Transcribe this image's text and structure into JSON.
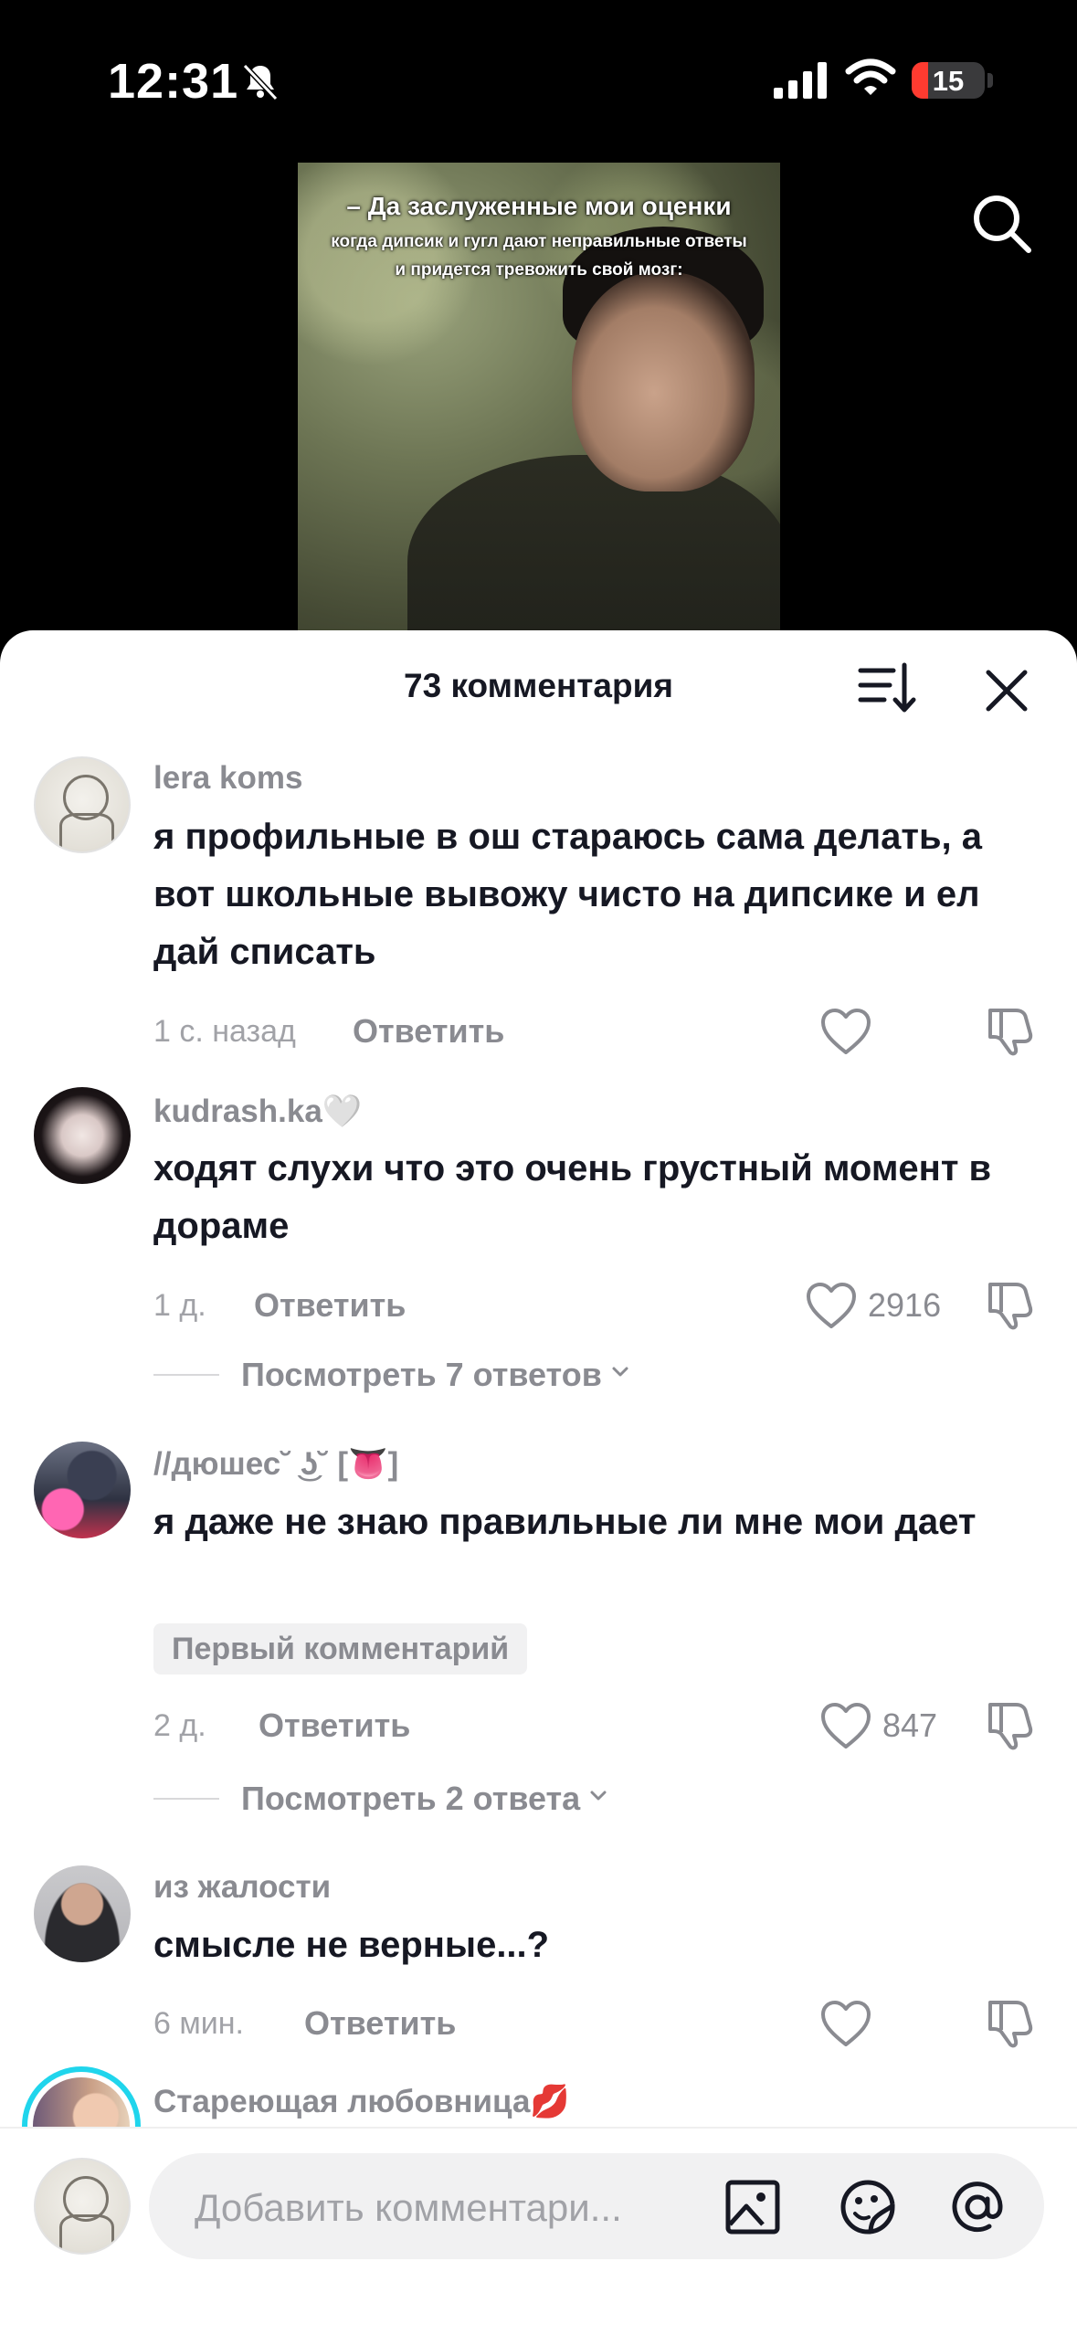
{
  "status_bar": {
    "time": "12:31",
    "battery_level": "15",
    "battery_fraction": 0.15,
    "icons": [
      "bell-slash-icon",
      "cellular-signal-icon",
      "wifi-icon",
      "battery-icon"
    ]
  },
  "video": {
    "caption_line1": "– Да заслуженные мои оценки",
    "caption_line2": "когда дипсик и гугл дают неправильные ответы",
    "caption_line3": "и придется тревожить свой мозг:"
  },
  "sheet": {
    "title": "73 комментария"
  },
  "comments": [
    {
      "username": "lera koms",
      "text": "я профильные в ош стараюсь сама делать, а вот школьные вывожу чисто на дипсике и ел дай списать",
      "time": "1 с. назад",
      "reply": "Ответить",
      "likes": ""
    },
    {
      "username": "kudrash.ka🤍",
      "text": "ходят слухи что это очень грустный момент в дораме",
      "time": "1 д.",
      "reply": "Ответить",
      "likes": "2916",
      "view_replies": "Посмотреть 7 ответов"
    },
    {
      "username": "//дюшес˘ ͜ʖ˘ [👅]",
      "text": "я даже не знаю правильные ли мне мои дает",
      "tag": "Первый комментарий",
      "time": "2 д.",
      "reply": "Ответить",
      "likes": "847",
      "view_replies": "Посмотреть 2 ответа"
    },
    {
      "username": "из жалости",
      "text": "смысле не верные...?",
      "time": "6 мин.",
      "reply": "Ответить",
      "likes": ""
    },
    {
      "username": "Стареющая любовница💋"
    }
  ],
  "input": {
    "placeholder": "Добавить комментари..."
  },
  "colors": {
    "accent_story_ring": "#20d5ec",
    "battery_low": "#ff3b30",
    "muted_text": "#8a8b91",
    "primary_text": "#161823"
  }
}
